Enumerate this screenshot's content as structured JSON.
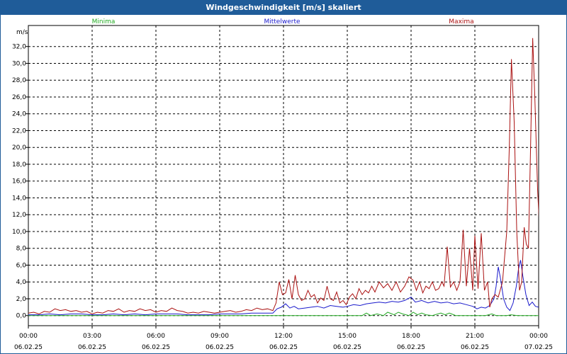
{
  "window": {
    "title": "Windgeschwindigkeit [m/s] skaliert"
  },
  "colors": {
    "min": "#22aa22",
    "avg": "#1a1acc",
    "max": "#aa1111",
    "titlebar": "#1f5c99"
  },
  "chart_data": {
    "type": "line",
    "title": "Windgeschwindigkeit [m/s] skaliert",
    "ylabel": "m/s",
    "ylim": [
      -1.2,
      34.5
    ],
    "yticks": [
      "0,0",
      "2,0",
      "4,0",
      "6,0",
      "8,0",
      "10,0",
      "12,0",
      "14,0",
      "16,0",
      "18,0",
      "20,0",
      "22,0",
      "24,0",
      "26,0",
      "28,0",
      "30,0",
      "32,0"
    ],
    "xlim": [
      0,
      24
    ],
    "xticks": [
      {
        "time": "00:00",
        "date": "06.02.25"
      },
      {
        "time": "03:00",
        "date": "06.02.25"
      },
      {
        "time": "06:00",
        "date": "06.02.25"
      },
      {
        "time": "09:00",
        "date": "06.02.25"
      },
      {
        "time": "12:00",
        "date": "06.02.25"
      },
      {
        "time": "15:00",
        "date": "06.02.25"
      },
      {
        "time": "18:00",
        "date": "06.02.25"
      },
      {
        "time": "21:00",
        "date": "06.02.25"
      },
      {
        "time": "00:00",
        "date": "07.02.25"
      }
    ],
    "grid": true,
    "legend": "top",
    "series": [
      {
        "name": "Minima",
        "color": "#22aa22",
        "points": [
          [
            0,
            0
          ],
          [
            15.7,
            0
          ],
          [
            15.9,
            0.3
          ],
          [
            16.1,
            0
          ],
          [
            16.4,
            0.2
          ],
          [
            16.7,
            0
          ],
          [
            16.9,
            0.4
          ],
          [
            17.2,
            0.1
          ],
          [
            17.4,
            0.4
          ],
          [
            17.6,
            0.2
          ],
          [
            17.9,
            0
          ],
          [
            18.1,
            0.4
          ],
          [
            18.3,
            0.1
          ],
          [
            18.5,
            0.3
          ],
          [
            18.7,
            0.1
          ],
          [
            19,
            0
          ],
          [
            19.4,
            0.3
          ],
          [
            19.6,
            0.1
          ],
          [
            19.8,
            0.3
          ],
          [
            20.1,
            0
          ],
          [
            21.5,
            0
          ],
          [
            21.8,
            0.2
          ],
          [
            22,
            0
          ],
          [
            22.5,
            0
          ],
          [
            22.7,
            0.1
          ],
          [
            23,
            0
          ],
          [
            24,
            0
          ]
        ]
      },
      {
        "name": "Mittelwerte",
        "color": "#1a1acc",
        "points": [
          [
            0,
            0.1
          ],
          [
            0.5,
            0.1
          ],
          [
            1,
            0.2
          ],
          [
            1.5,
            0.1
          ],
          [
            2,
            0.2
          ],
          [
            2.5,
            0.2
          ],
          [
            3,
            0.1
          ],
          [
            3.5,
            0.1
          ],
          [
            4,
            0.2
          ],
          [
            4.5,
            0.1
          ],
          [
            5,
            0.2
          ],
          [
            5.5,
            0.1
          ],
          [
            6,
            0.2
          ],
          [
            6.5,
            0.2
          ],
          [
            7,
            0.2
          ],
          [
            7.5,
            0.1
          ],
          [
            8,
            0.1
          ],
          [
            8.5,
            0.1
          ],
          [
            9,
            0.2
          ],
          [
            9.5,
            0.2
          ],
          [
            10,
            0.2
          ],
          [
            10.5,
            0.3
          ],
          [
            11,
            0.3
          ],
          [
            11.5,
            0.3
          ],
          [
            11.7,
            0.8
          ],
          [
            11.9,
            1.0
          ],
          [
            12.1,
            1.4
          ],
          [
            12.3,
            0.9
          ],
          [
            12.5,
            1.1
          ],
          [
            12.7,
            0.8
          ],
          [
            13,
            0.9
          ],
          [
            13.3,
            1.0
          ],
          [
            13.6,
            1.1
          ],
          [
            13.9,
            0.9
          ],
          [
            14.2,
            1.2
          ],
          [
            14.5,
            1.1
          ],
          [
            14.8,
            1.0
          ],
          [
            15,
            1.1
          ],
          [
            15.3,
            1.3
          ],
          [
            15.6,
            1.2
          ],
          [
            15.9,
            1.4
          ],
          [
            16.2,
            1.5
          ],
          [
            16.5,
            1.6
          ],
          [
            16.8,
            1.5
          ],
          [
            17.1,
            1.7
          ],
          [
            17.4,
            1.6
          ],
          [
            17.7,
            1.8
          ],
          [
            18,
            2.2
          ],
          [
            18.2,
            1.6
          ],
          [
            18.5,
            1.8
          ],
          [
            18.8,
            1.5
          ],
          [
            19.1,
            1.7
          ],
          [
            19.4,
            1.5
          ],
          [
            19.7,
            1.6
          ],
          [
            20,
            1.4
          ],
          [
            20.3,
            1.5
          ],
          [
            20.6,
            1.3
          ],
          [
            20.9,
            1.1
          ],
          [
            21.1,
            0.8
          ],
          [
            21.3,
            1.0
          ],
          [
            21.5,
            0.9
          ],
          [
            21.7,
            1.2
          ],
          [
            21.9,
            2.0
          ],
          [
            22.0,
            3.5
          ],
          [
            22.1,
            5.8
          ],
          [
            22.2,
            4.5
          ],
          [
            22.35,
            2.0
          ],
          [
            22.5,
            1.0
          ],
          [
            22.65,
            0.6
          ],
          [
            22.8,
            1.5
          ],
          [
            22.95,
            3.5
          ],
          [
            23.05,
            5.5
          ],
          [
            23.15,
            6.6
          ],
          [
            23.25,
            4.8
          ],
          [
            23.4,
            2.5
          ],
          [
            23.55,
            1.2
          ],
          [
            23.7,
            1.6
          ],
          [
            23.85,
            1.1
          ],
          [
            24,
            1.0
          ]
        ]
      },
      {
        "name": "Maxima",
        "color": "#aa1111",
        "points": [
          [
            0,
            0.3
          ],
          [
            0.25,
            0.4
          ],
          [
            0.5,
            0.2
          ],
          [
            0.75,
            0.5
          ],
          [
            1,
            0.4
          ],
          [
            1.25,
            0.8
          ],
          [
            1.5,
            0.6
          ],
          [
            1.75,
            0.7
          ],
          [
            2,
            0.5
          ],
          [
            2.25,
            0.6
          ],
          [
            2.5,
            0.4
          ],
          [
            2.75,
            0.5
          ],
          [
            3,
            0.2
          ],
          [
            3.25,
            0.4
          ],
          [
            3.5,
            0.3
          ],
          [
            3.75,
            0.6
          ],
          [
            4,
            0.5
          ],
          [
            4.25,
            0.8
          ],
          [
            4.5,
            0.4
          ],
          [
            4.75,
            0.6
          ],
          [
            5,
            0.5
          ],
          [
            5.25,
            0.8
          ],
          [
            5.5,
            0.6
          ],
          [
            5.75,
            0.7
          ],
          [
            6,
            0.4
          ],
          [
            6.25,
            0.6
          ],
          [
            6.5,
            0.5
          ],
          [
            6.75,
            0.9
          ],
          [
            7,
            0.6
          ],
          [
            7.25,
            0.5
          ],
          [
            7.5,
            0.3
          ],
          [
            7.75,
            0.4
          ],
          [
            8,
            0.3
          ],
          [
            8.25,
            0.5
          ],
          [
            8.5,
            0.4
          ],
          [
            8.75,
            0.3
          ],
          [
            9,
            0.4
          ],
          [
            9.25,
            0.5
          ],
          [
            9.5,
            0.6
          ],
          [
            9.75,
            0.4
          ],
          [
            10,
            0.5
          ],
          [
            10.25,
            0.7
          ],
          [
            10.5,
            0.6
          ],
          [
            10.75,
            0.9
          ],
          [
            11,
            0.7
          ],
          [
            11.25,
            0.8
          ],
          [
            11.5,
            0.6
          ],
          [
            11.65,
            1.5
          ],
          [
            11.8,
            4.0
          ],
          [
            11.95,
            2.5
          ],
          [
            12.1,
            2.7
          ],
          [
            12.25,
            4.3
          ],
          [
            12.4,
            2.0
          ],
          [
            12.55,
            4.8
          ],
          [
            12.7,
            2.5
          ],
          [
            12.85,
            1.8
          ],
          [
            13,
            2.0
          ],
          [
            13.15,
            3.0
          ],
          [
            13.3,
            2.2
          ],
          [
            13.45,
            2.5
          ],
          [
            13.6,
            1.5
          ],
          [
            13.75,
            2.1
          ],
          [
            13.9,
            1.8
          ],
          [
            14.05,
            3.5
          ],
          [
            14.2,
            2.0
          ],
          [
            14.35,
            1.8
          ],
          [
            14.5,
            2.8
          ],
          [
            14.65,
            1.5
          ],
          [
            14.8,
            1.8
          ],
          [
            14.95,
            1.3
          ],
          [
            15.1,
            2.2
          ],
          [
            15.25,
            2.6
          ],
          [
            15.4,
            2.0
          ],
          [
            15.55,
            3.2
          ],
          [
            15.7,
            2.5
          ],
          [
            15.85,
            3.0
          ],
          [
            16,
            2.7
          ],
          [
            16.15,
            3.5
          ],
          [
            16.3,
            2.8
          ],
          [
            16.5,
            4.0
          ],
          [
            16.7,
            3.3
          ],
          [
            16.9,
            3.8
          ],
          [
            17.1,
            3.0
          ],
          [
            17.3,
            4.0
          ],
          [
            17.5,
            2.8
          ],
          [
            17.7,
            3.5
          ],
          [
            17.9,
            4.6
          ],
          [
            18.1,
            4.2
          ],
          [
            18.25,
            3.0
          ],
          [
            18.4,
            4.0
          ],
          [
            18.55,
            2.7
          ],
          [
            18.7,
            3.5
          ],
          [
            18.85,
            3.2
          ],
          [
            19,
            4.0
          ],
          [
            19.15,
            3.0
          ],
          [
            19.3,
            3.2
          ],
          [
            19.45,
            4.0
          ],
          [
            19.55,
            3.5
          ],
          [
            19.7,
            8.2
          ],
          [
            19.85,
            3.4
          ],
          [
            20,
            4.0
          ],
          [
            20.15,
            3.0
          ],
          [
            20.3,
            4.0
          ],
          [
            20.45,
            10.2
          ],
          [
            20.6,
            3.5
          ],
          [
            20.75,
            8.0
          ],
          [
            20.9,
            3.0
          ],
          [
            21.0,
            9.5
          ],
          [
            21.15,
            3.2
          ],
          [
            21.3,
            9.8
          ],
          [
            21.45,
            3.0
          ],
          [
            21.6,
            4.0
          ],
          [
            21.7,
            1.0
          ],
          [
            21.8,
            2.0
          ],
          [
            21.95,
            2.5
          ],
          [
            22.1,
            2.2
          ],
          [
            22.3,
            4.0
          ],
          [
            22.5,
            10.0
          ],
          [
            22.62,
            20.0
          ],
          [
            22.72,
            30.5
          ],
          [
            22.85,
            23.0
          ],
          [
            22.97,
            10.0
          ],
          [
            23.1,
            3.0
          ],
          [
            23.2,
            4.0
          ],
          [
            23.32,
            10.5
          ],
          [
            23.42,
            8.5
          ],
          [
            23.52,
            8.0
          ],
          [
            23.62,
            20.0
          ],
          [
            23.72,
            33.0
          ],
          [
            23.82,
            26.0
          ],
          [
            23.95,
            15.0
          ],
          [
            24.05,
            10.0
          ],
          [
            24.2,
            5.0
          ],
          [
            24.35,
            3.0
          ],
          [
            24.5,
            2.5
          ],
          [
            24.6,
            6.3
          ],
          [
            24.75,
            3.0
          ],
          [
            24.9,
            3.3
          ]
        ]
      }
    ]
  }
}
